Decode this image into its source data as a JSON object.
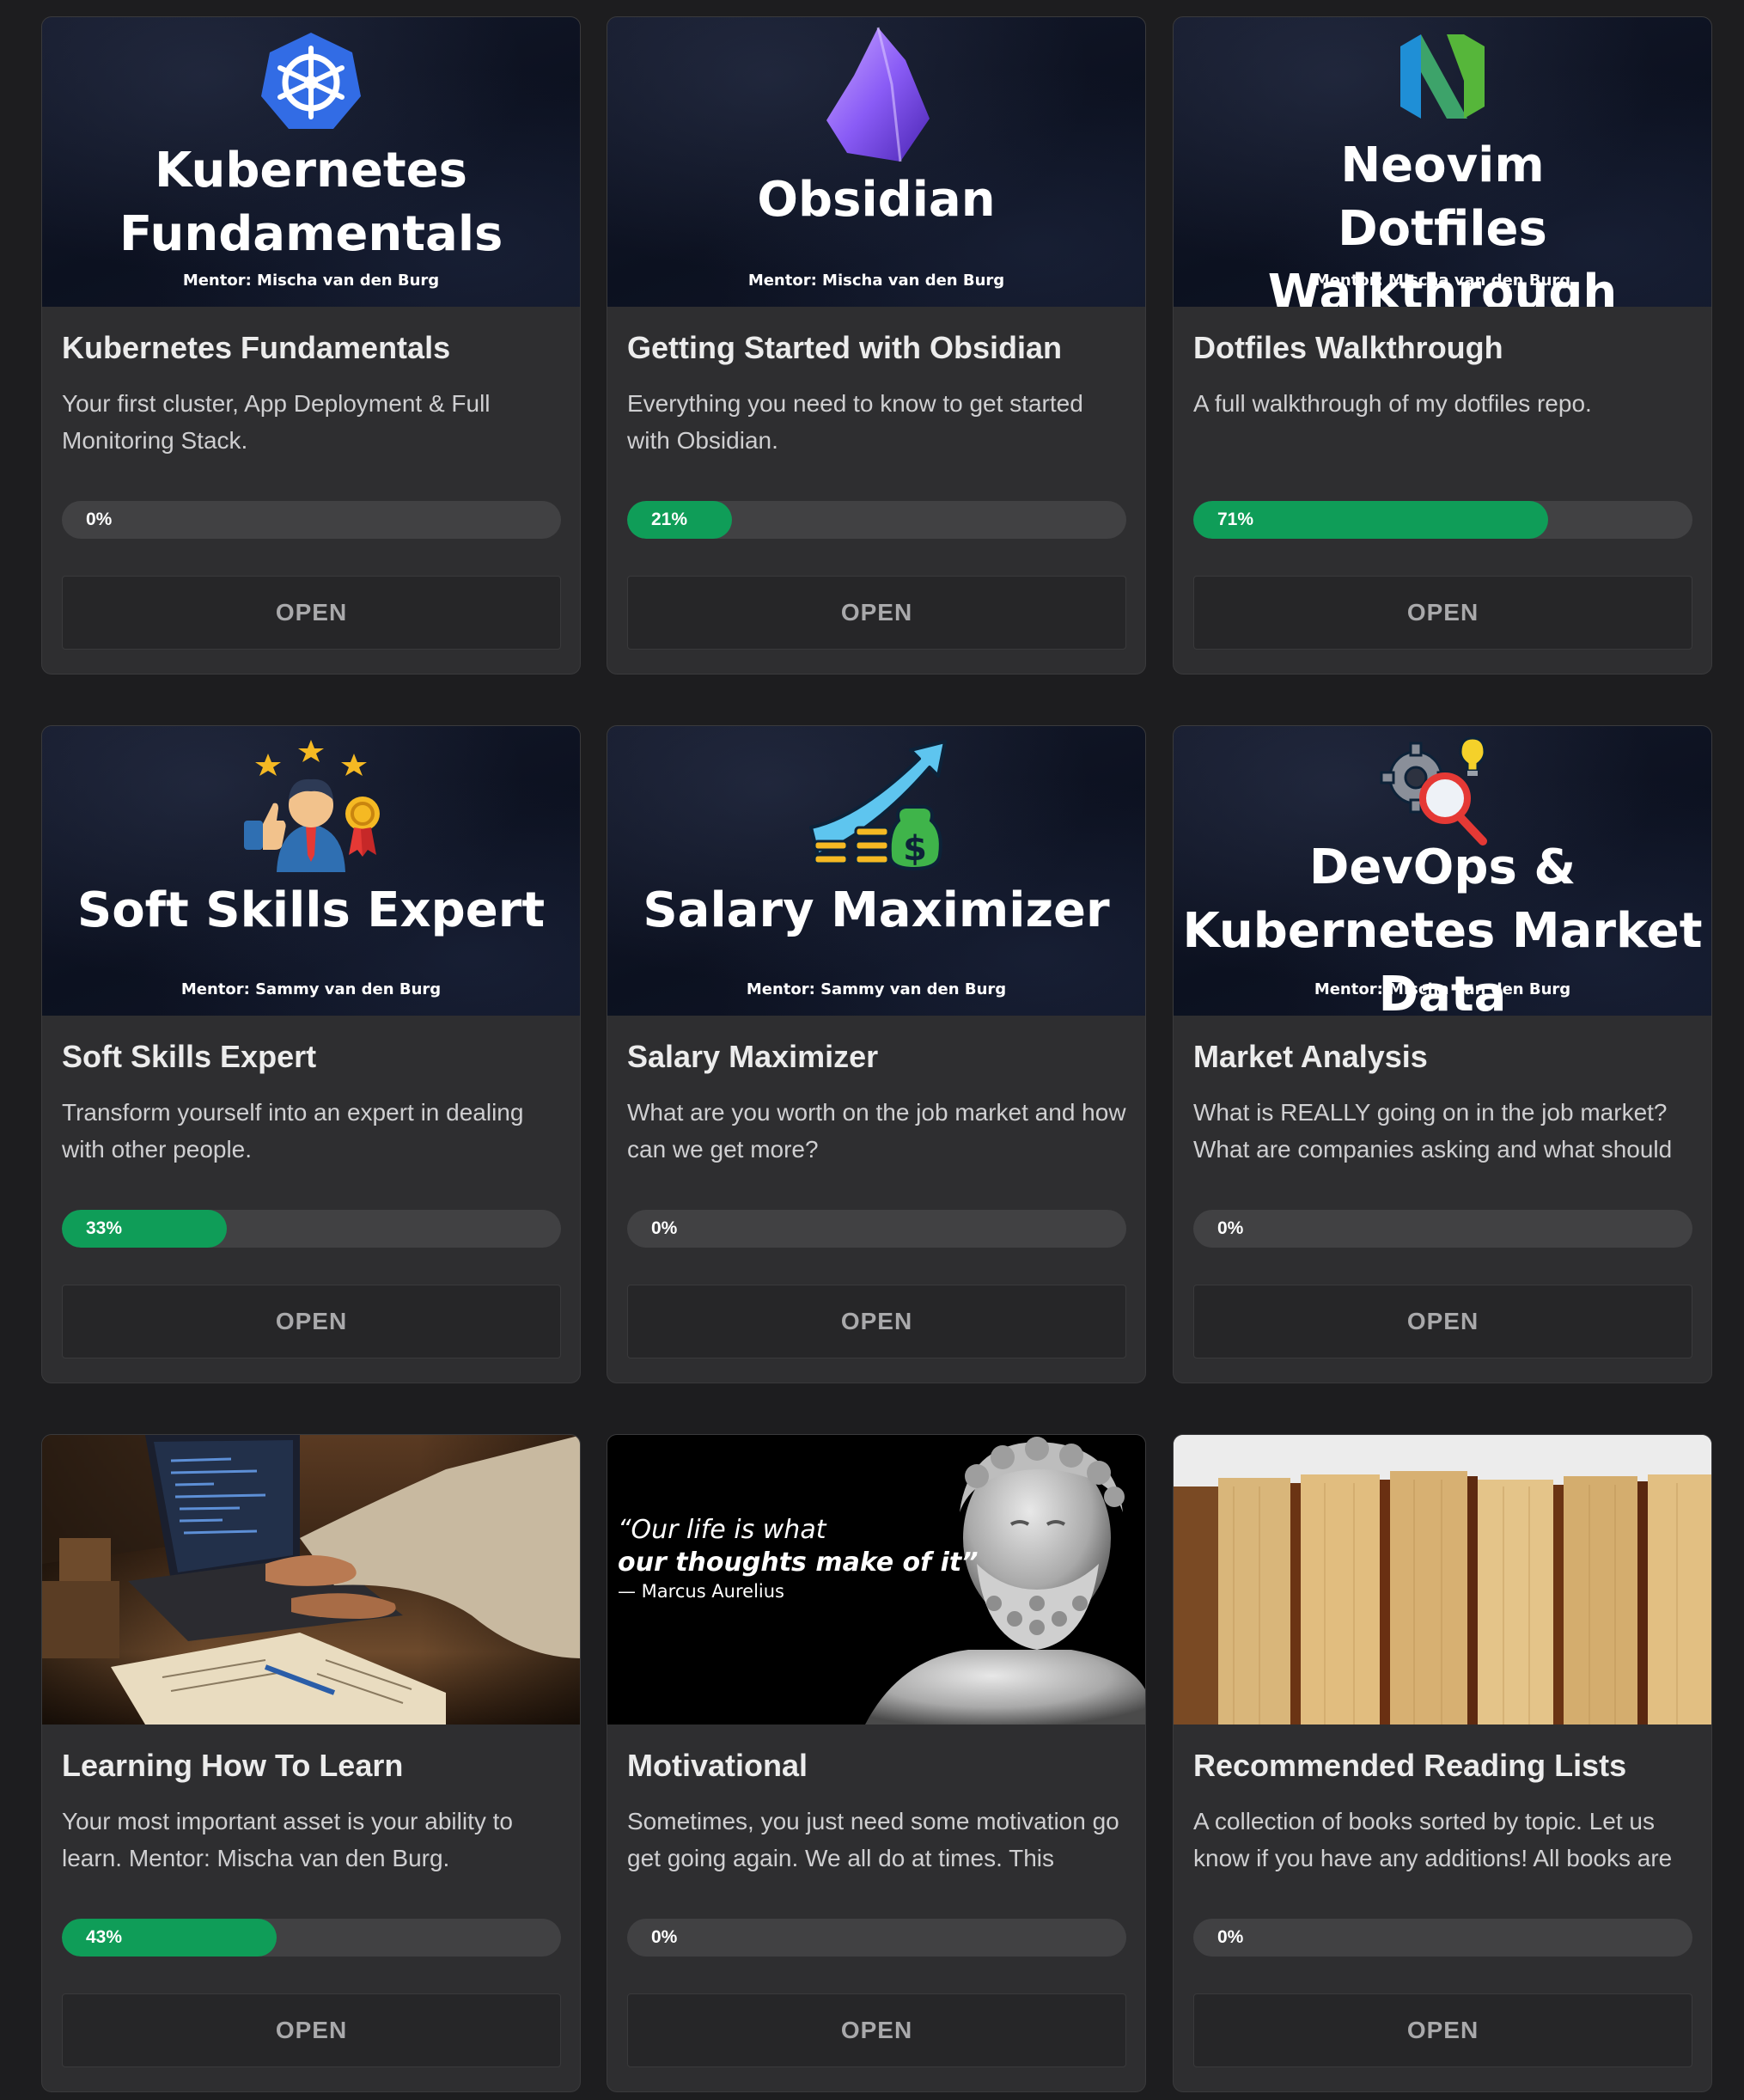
{
  "open_label": "OPEN",
  "courses": [
    {
      "banner_title": "Kubernetes Fundamentals",
      "banner_mentor": "Mentor: Mischa van den Burg",
      "title": "Kubernetes Fundamentals",
      "description": "Your first cluster, App Deployment & Full Monitoring Stack.",
      "progress_label": "0%",
      "progress": 0,
      "icon": "kubernetes-icon"
    },
    {
      "banner_title": "Obsidian",
      "banner_mentor": "Mentor: Mischa van den Burg",
      "title": "Getting Started with Obsidian",
      "description": "Everything you need to know to get started with Obsidian.",
      "progress_label": "21%",
      "progress": 21,
      "icon": "obsidian-icon"
    },
    {
      "banner_title": "Neovim Dotfiles Walkthrough",
      "banner_mentor": "Mentor: Mischa van den Burg",
      "title": "Dotfiles Walkthrough",
      "description": "A full walkthrough of my dotfiles repo.",
      "progress_label": "71%",
      "progress": 71,
      "icon": "neovim-icon"
    },
    {
      "banner_title": "Soft Skills Expert",
      "banner_mentor": "Mentor: Sammy van den Burg",
      "title": "Soft Skills Expert",
      "description": "Transform yourself into an expert in dealing with other people.",
      "progress_label": "33%",
      "progress": 33,
      "icon": "businessman-icon"
    },
    {
      "banner_title": "Salary Maximizer",
      "banner_mentor": "Mentor: Sammy van den Burg",
      "title": "Salary Maximizer",
      "description": "What are you worth on the job market and how can we get more?",
      "progress_label": "0%",
      "progress": 0,
      "icon": "money-growth-icon"
    },
    {
      "banner_title": "DevOps & Kubernetes Market Data",
      "banner_mentor": "Mentor: Mischa van den Burg",
      "title": "Market Analysis",
      "description": "What is REALLY going on in the job market? What are companies asking and what should",
      "progress_label": "0%",
      "progress": 0,
      "icon": "gear-search-icon"
    },
    {
      "title": "Learning How To Learn",
      "description": "Your most important asset is your ability to learn. Mentor: Mischa van den Burg.",
      "progress_label": "43%",
      "progress": 43,
      "icon": "study-photo"
    },
    {
      "quote_line1": "“Our life is what",
      "quote_line2": "our thoughts make of it”",
      "quote_author": "— Marcus Aurelius",
      "title": "Motivational",
      "description": "Sometimes, you just need some motivation go get going again. We all do at times. This",
      "progress_label": "0%",
      "progress": 0,
      "icon": "marcus-aurelius-bust"
    },
    {
      "title": "Recommended Reading Lists",
      "description": "A collection of books sorted by topic. Let us know if you have any additions! All books are",
      "progress_label": "0%",
      "progress": 0,
      "icon": "books-photo"
    }
  ]
}
